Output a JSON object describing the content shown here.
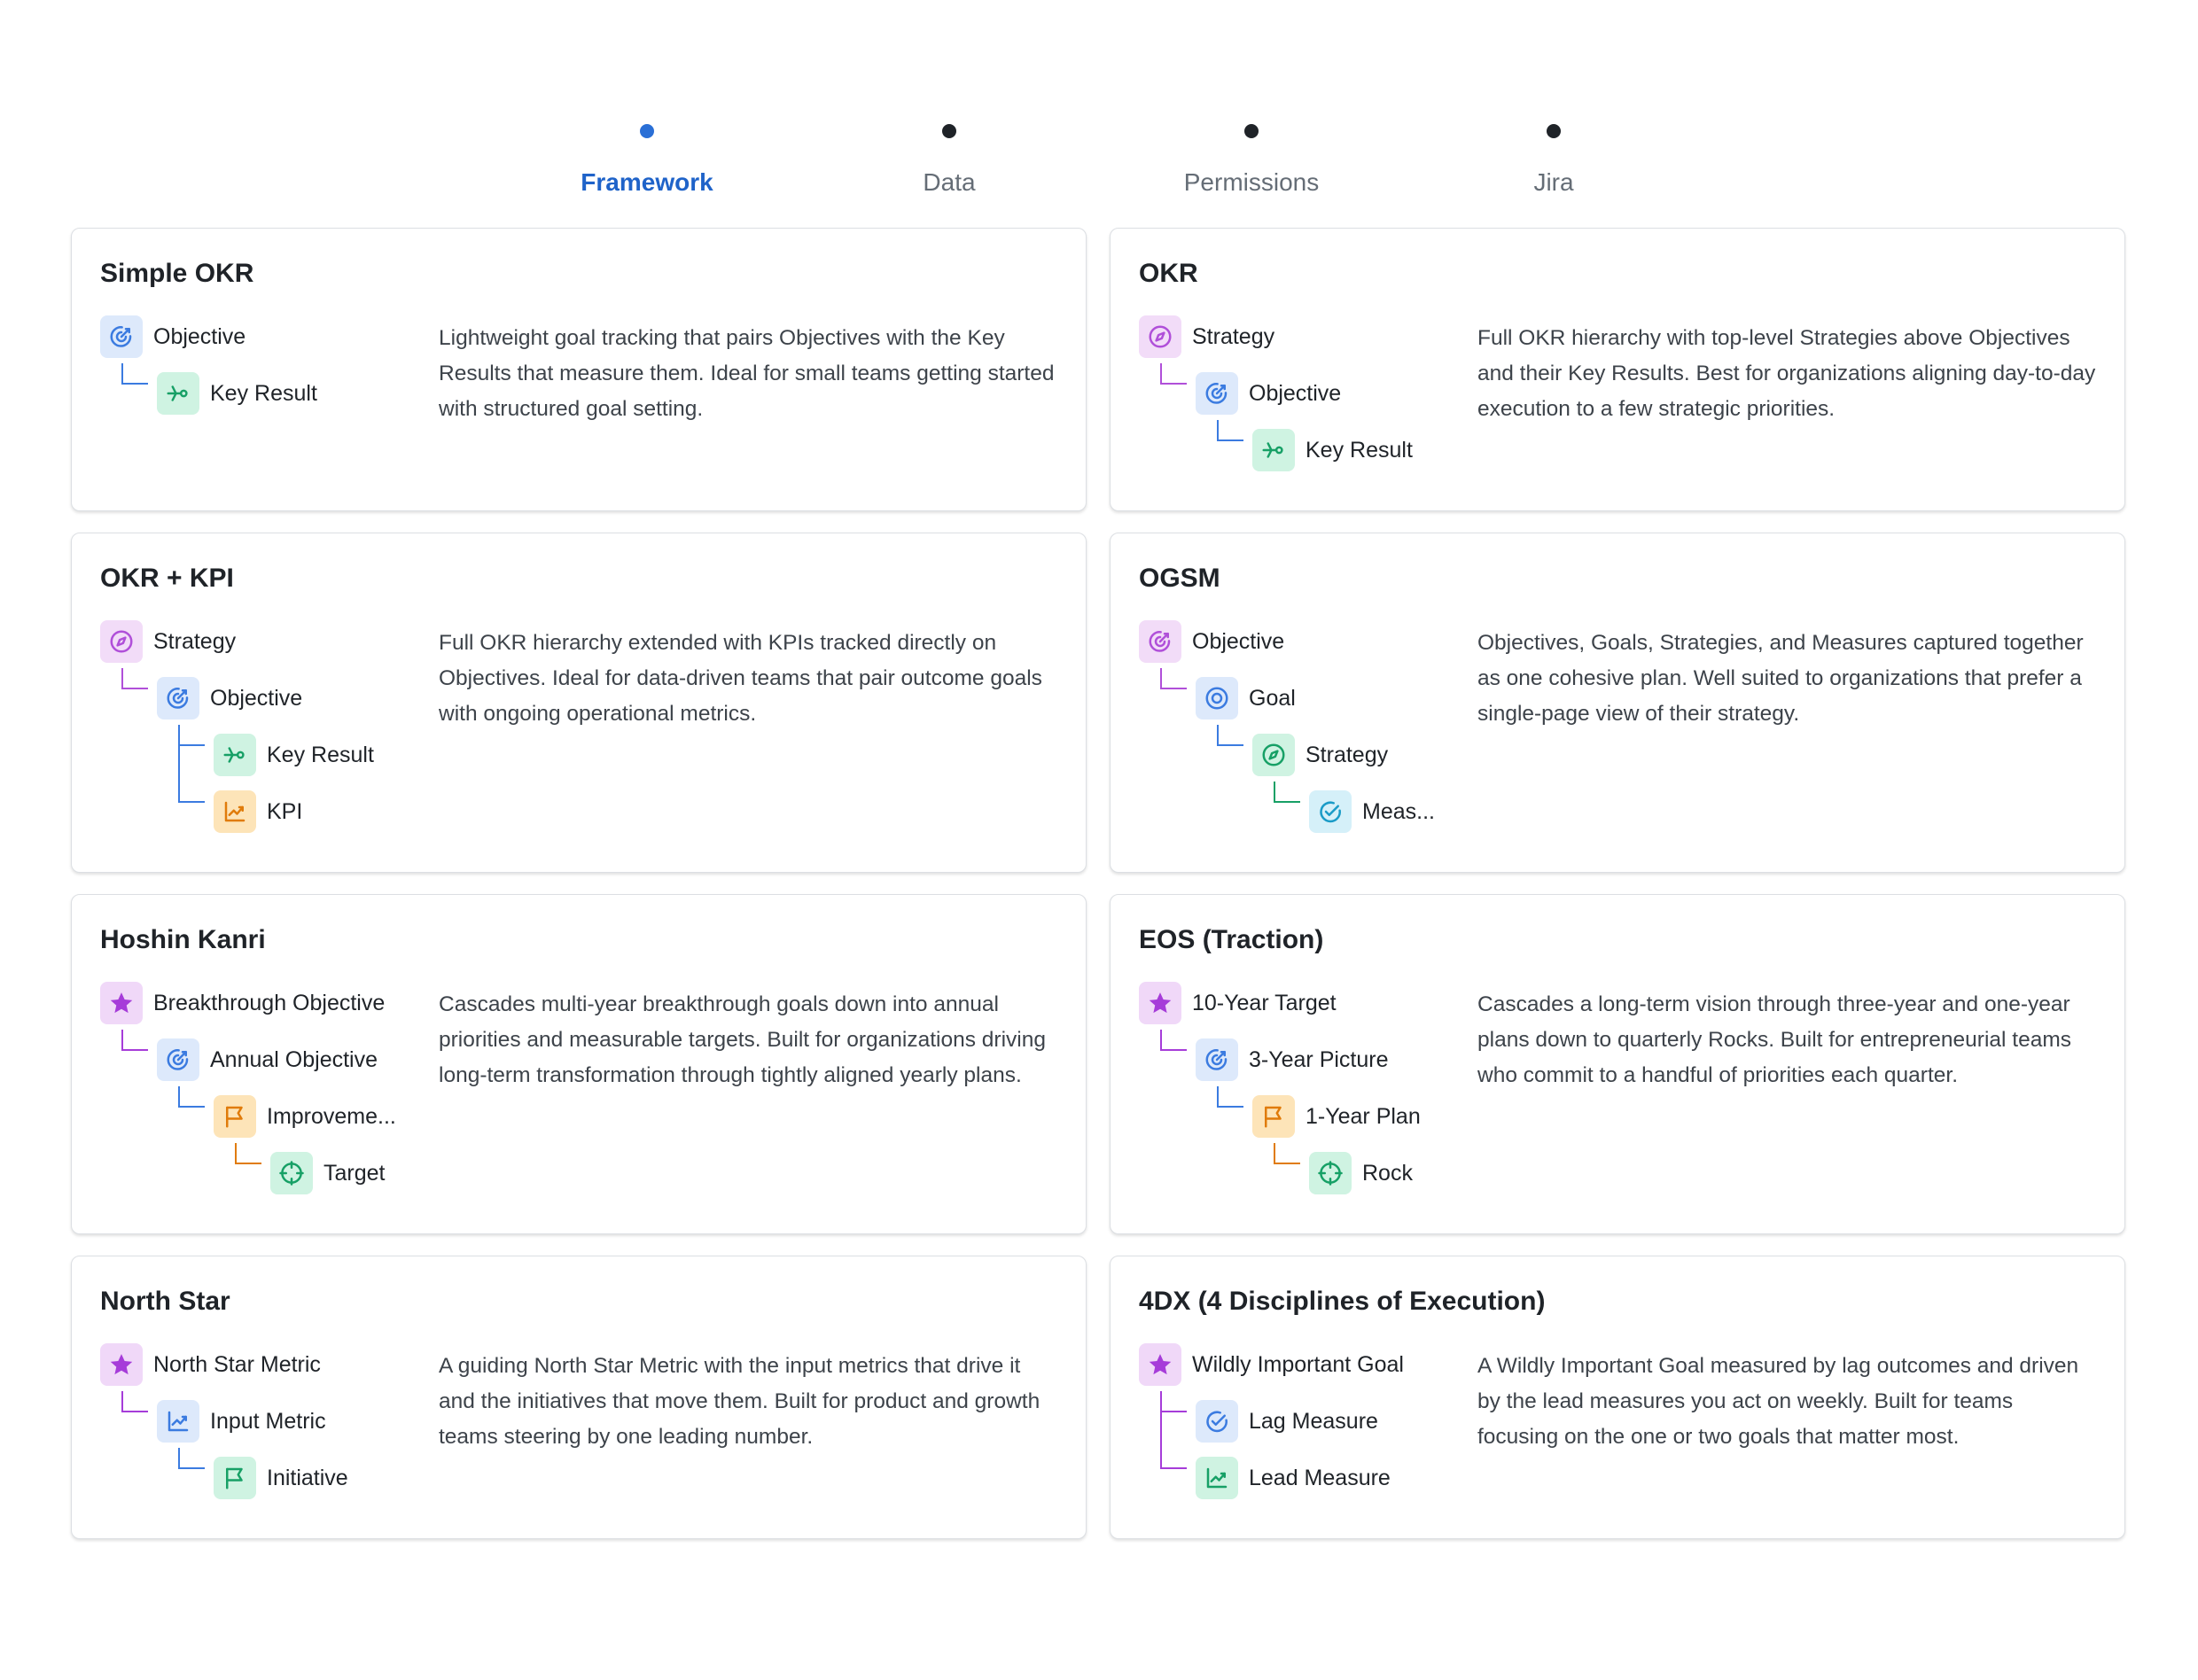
{
  "stepper": {
    "steps": [
      {
        "label": "Framework",
        "active": true
      },
      {
        "label": "Data",
        "active": false
      },
      {
        "label": "Permissions",
        "active": false
      },
      {
        "label": "Jira",
        "active": false
      }
    ]
  },
  "colors": {
    "accent": "#1f63c9",
    "objective": "#3b7be0",
    "key_result": "#17a066",
    "strategy": "#b04fd9",
    "kpi": "#e07b0a",
    "measure": "#1a9bc7",
    "star": "#a63cd9"
  },
  "cards": [
    {
      "title": "Simple OKR",
      "description": "Lightweight goal tracking that pairs Objectives with the Key Results that measure them. Ideal for small teams getting started with structured goal setting.",
      "nodes": [
        {
          "label": "Objective",
          "icon": "target-arrow-icon",
          "color": "blue"
        },
        {
          "label": "Key Result",
          "icon": "key-result-icon",
          "color": "green"
        }
      ]
    },
    {
      "title": "OKR",
      "description": "Full OKR hierarchy with top-level Strategies above Objectives and their Key Results. Best for organizations aligning day-to-day execution to a few strategic priorities.",
      "nodes": [
        {
          "label": "Strategy",
          "icon": "compass-icon",
          "color": "purple"
        },
        {
          "label": "Objective",
          "icon": "target-arrow-icon",
          "color": "blue"
        },
        {
          "label": "Key Result",
          "icon": "key-result-icon",
          "color": "green"
        }
      ]
    },
    {
      "title": "OKR + KPI",
      "description": "Full OKR hierarchy extended with KPIs tracked directly on Objectives. Ideal for data-driven teams that pair outcome goals with ongoing operational metrics.",
      "nodes": [
        {
          "label": "Strategy",
          "icon": "compass-icon",
          "color": "purple"
        },
        {
          "label": "Objective",
          "icon": "target-arrow-icon",
          "color": "blue"
        },
        {
          "label": "Key Result",
          "icon": "key-result-icon",
          "color": "green"
        },
        {
          "label": "KPI",
          "icon": "chart-line-icon",
          "color": "orange"
        }
      ]
    },
    {
      "title": "OGSM",
      "description": "Objectives, Goals, Strategies, and Measures captured together as one cohesive plan. Well suited to organizations that prefer a single-page view of their strategy.",
      "nodes": [
        {
          "label": "Objective",
          "icon": "target-arrow-icon",
          "color": "purple"
        },
        {
          "label": "Goal",
          "icon": "bullseye-icon",
          "color": "blue"
        },
        {
          "label": "Strategy",
          "icon": "compass-icon",
          "color": "green"
        },
        {
          "label": "Meas...",
          "icon": "check-circle-icon",
          "color": "cyan"
        }
      ]
    },
    {
      "title": "Hoshin Kanri",
      "description": "Cascades multi-year breakthrough goals down into annual priorities and measurable targets. Built for organizations driving long-term transformation through tightly aligned yearly plans.",
      "nodes": [
        {
          "label": "Breakthrough Objective",
          "icon": "star-icon",
          "color": "star"
        },
        {
          "label": "Annual Objective",
          "icon": "target-arrow-icon",
          "color": "blue"
        },
        {
          "label": "Improveme...",
          "icon": "flag-icon",
          "color": "orange"
        },
        {
          "label": "Target",
          "icon": "crosshair-icon",
          "color": "green"
        }
      ]
    },
    {
      "title": "EOS (Traction)",
      "description": "Cascades a long-term vision through three-year and one-year plans down to quarterly Rocks. Built for entrepreneurial teams who commit to a handful of priorities each quarter.",
      "nodes": [
        {
          "label": "10-Year Target",
          "icon": "star-icon",
          "color": "star"
        },
        {
          "label": "3-Year Picture",
          "icon": "target-arrow-icon",
          "color": "blue"
        },
        {
          "label": "1-Year Plan",
          "icon": "flag-icon",
          "color": "orange"
        },
        {
          "label": "Rock",
          "icon": "crosshair-icon",
          "color": "green"
        }
      ]
    },
    {
      "title": "North Star",
      "description": "A guiding North Star Metric with the input metrics that drive it and the initiatives that move them. Built for product and growth teams steering by one leading number.",
      "nodes": [
        {
          "label": "North Star Metric",
          "icon": "star-icon",
          "color": "star"
        },
        {
          "label": "Input Metric",
          "icon": "chart-line-icon",
          "color": "blue"
        },
        {
          "label": "Initiative",
          "icon": "flag-icon",
          "color": "green"
        }
      ]
    },
    {
      "title": "4DX (4 Disciplines of Execution)",
      "description": "A Wildly Important Goal measured by lag outcomes and driven by the lead measures you act on weekly. Built for teams focusing on the one or two goals that matter most.",
      "nodes": [
        {
          "label": "Wildly Important Goal",
          "icon": "star-icon",
          "color": "star"
        },
        {
          "label": "Lag Measure",
          "icon": "check-circle-icon",
          "color": "blue"
        },
        {
          "label": "Lead Measure",
          "icon": "chart-line-icon",
          "color": "green"
        }
      ]
    }
  ]
}
